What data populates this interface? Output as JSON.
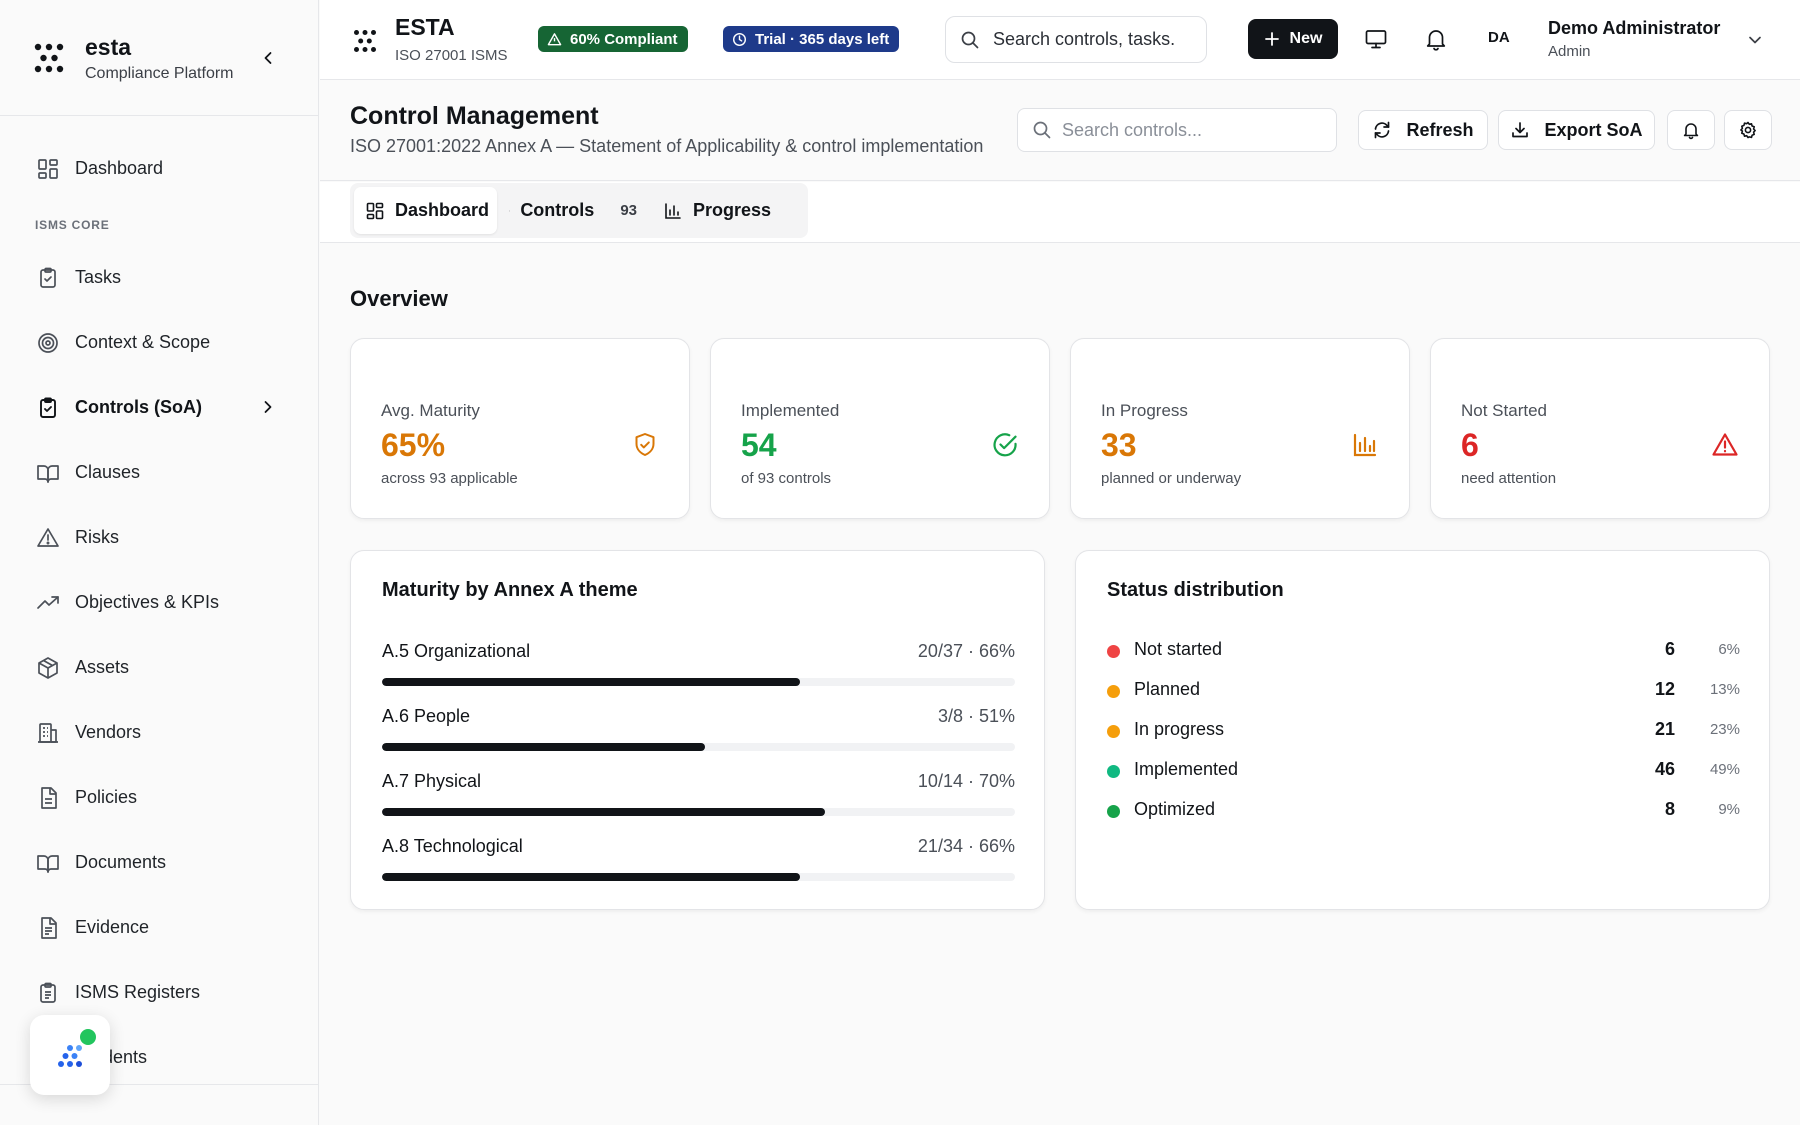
{
  "sidebar": {
    "brand_name": "esta",
    "brand_sub": "Compliance Platform",
    "section_label": "ISMS CORE",
    "items": [
      {
        "label": "Dashboard",
        "icon": "grid-icon"
      },
      {
        "label": "Tasks",
        "icon": "clipboard-icon"
      },
      {
        "label": "Context & Scope",
        "icon": "target-icon"
      },
      {
        "label": "Controls (SoA)",
        "icon": "clipboard-check-icon",
        "active": true
      },
      {
        "label": "Clauses",
        "icon": "book-icon"
      },
      {
        "label": "Risks",
        "icon": "warning-icon"
      },
      {
        "label": "Objectives & KPIs",
        "icon": "trend-icon"
      },
      {
        "label": "Assets",
        "icon": "box-icon"
      },
      {
        "label": "Vendors",
        "icon": "building-icon"
      },
      {
        "label": "Policies",
        "icon": "file-icon"
      },
      {
        "label": "Documents",
        "icon": "book-open-icon"
      },
      {
        "label": "Evidence",
        "icon": "file-text-icon"
      },
      {
        "label": "ISMS Registers",
        "icon": "register-icon"
      },
      {
        "label": "Incidents",
        "icon": "alert-icon"
      }
    ]
  },
  "topbar": {
    "title": "ESTA",
    "subtitle": "ISO 27001 ISMS",
    "compliance_badge": "60% Compliant",
    "trial_badge": "Trial · 365 days left",
    "search_text": "Search controls, tasks.",
    "new_label": "New",
    "avatar_initials": "DA",
    "user_name": "Demo Administrator",
    "user_role": "Admin"
  },
  "page": {
    "title": "Control Management",
    "subtitle": "ISO 27001:2022 Annex A — Statement of Applicability & control implementation",
    "search_placeholder": "Search controls...",
    "refresh_label": "Refresh",
    "export_label": "Export SoA"
  },
  "tabs": [
    {
      "label": "Dashboard",
      "active": true
    },
    {
      "label": "Controls",
      "count": "93"
    },
    {
      "label": "Progress"
    }
  ],
  "overview": {
    "title": "Overview",
    "cards": [
      {
        "label": "Avg. Maturity",
        "value": "65%",
        "caption": "across 93 applicable",
        "color": "#d97706",
        "icon": "shield-check-icon"
      },
      {
        "label": "Implemented",
        "value": "54",
        "caption": "of 93 controls",
        "color": "#16a34a",
        "icon": "check-circle-icon"
      },
      {
        "label": "In Progress",
        "value": "33",
        "caption": "planned or underway",
        "color": "#d97706",
        "icon": "bar-chart-icon"
      },
      {
        "label": "Not Started",
        "value": "6",
        "caption": "need attention",
        "color": "#dc2626",
        "icon": "warning-triangle-icon"
      }
    ]
  },
  "maturity": {
    "title": "Maturity by Annex A theme",
    "themes": [
      {
        "name": "A.5 Organizational",
        "stat": "20/37 · 66%",
        "percent": 66
      },
      {
        "name": "A.6 People",
        "stat": "3/8 · 51%",
        "percent": 51
      },
      {
        "name": "A.7 Physical",
        "stat": "10/14 · 70%",
        "percent": 70
      },
      {
        "name": "A.8 Technological",
        "stat": "21/34 · 66%",
        "percent": 66
      }
    ]
  },
  "status": {
    "title": "Status distribution",
    "rows": [
      {
        "name": "Not started",
        "count": "6",
        "pct": "6%",
        "color": "#ef4444"
      },
      {
        "name": "Planned",
        "count": "12",
        "pct": "13%",
        "color": "#f59e0b"
      },
      {
        "name": "In progress",
        "count": "21",
        "pct": "23%",
        "color": "#f59e0b"
      },
      {
        "name": "Implemented",
        "count": "46",
        "pct": "49%",
        "color": "#10b981"
      },
      {
        "name": "Optimized",
        "count": "8",
        "pct": "9%",
        "color": "#16a34a"
      }
    ]
  }
}
